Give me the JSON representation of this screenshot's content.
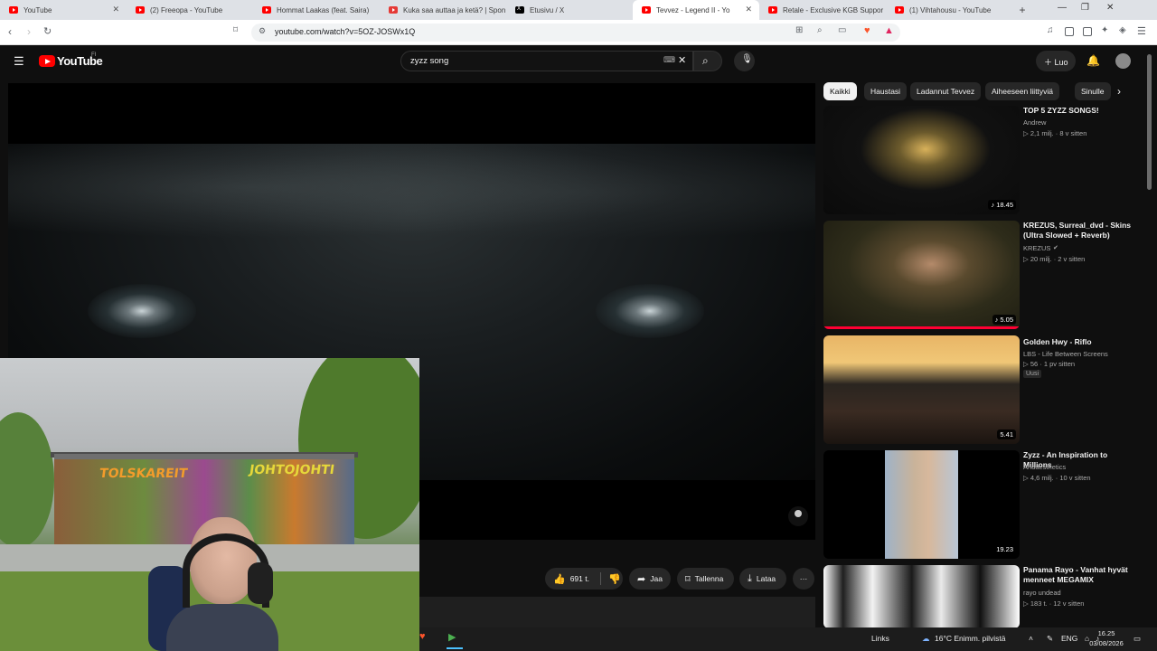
{
  "browser": {
    "tabs": [
      {
        "title": "YouTube",
        "icon": "youtube-icon"
      },
      {
        "title": "(2) Freeopa - YouTube",
        "icon": "youtube-icon"
      },
      {
        "title": "Hommat Laakas (feat. Saira)",
        "icon": "youtube-icon"
      },
      {
        "title": "Kuka saa auttaa ja ketä? | Spon",
        "icon": "youtube-icon"
      },
      {
        "title": "Etusivu / X",
        "icon": "x-icon"
      },
      {
        "title": "Tevvez - Legend II - Yo",
        "icon": "youtube-icon",
        "active": true
      },
      {
        "title": "Retale - Exclusive KGB Suppor",
        "icon": "youtube-icon"
      },
      {
        "title": "(1) Vihtahousu - YouTube",
        "icon": "youtube-icon"
      }
    ],
    "url": "youtube.com/watch?v=5OZ-JOSWx1Q",
    "new_tab": "+",
    "window_controls": [
      "—",
      "❐",
      "✕"
    ]
  },
  "youtube": {
    "logo_text": "YouTube",
    "logo_sup": "FI",
    "search_value": "zyzz song",
    "create_label": "Luo"
  },
  "actions": {
    "like_count": "691 t.",
    "share": "Jaa",
    "save": "Tallenna",
    "download": "Lataa",
    "more": "···"
  },
  "chips": [
    {
      "label": "Kaikki",
      "active": true
    },
    {
      "label": "Haustasi"
    },
    {
      "label": "Ladannut Tevvez"
    },
    {
      "label": "Aiheeseen liittyviä"
    },
    {
      "label": "Sinulle"
    }
  ],
  "recommendations": [
    {
      "title": "TOP 5 ZYZZ SONGS!",
      "channel": "Andrew",
      "meta": "▷ 2,1 milj. · 8 v sitten",
      "duration": "♪ 18.45"
    },
    {
      "title": "KREZUS, Surreal_dvd - Skins (Ultra Slowed + Reverb)",
      "channel": "KREZUS",
      "meta": "▷ 20 milj. · 2 v sitten",
      "duration": "♪ 5.05",
      "verified": true,
      "watched": true
    },
    {
      "title": "Golden Hwy - Riflo",
      "channel": "LBS - Life Between Screens",
      "meta": "▷ 56 · 1 pv sitten",
      "duration": "5.41",
      "badge": "Uusi"
    },
    {
      "title": "Zyzz - An Inspiration to Millions",
      "channel": "Andaesthetics",
      "meta": "▷ 4,6 milj. · 10 v sitten",
      "duration": "19.23"
    },
    {
      "title": "Panama Rayo - Vanhat hyvät menneet MEGAMIX",
      "channel": "rayo undead",
      "meta": "▷ 183 t. · 12 v sitten",
      "duration": ""
    }
  ],
  "webcam": {
    "graffiti_left": "TOLSKAREIT",
    "graffiti_right": "JOHTOJOHTI"
  },
  "taskbar": {
    "links": "Links",
    "weather": "16°C  Enimm. pilvistä",
    "lang": "ENG",
    "time": "16.25",
    "date": "03/08/2026"
  },
  "colors": {
    "youtube_red": "#ff0000",
    "background": "#0f0f0f",
    "chip_bg": "#272727"
  }
}
